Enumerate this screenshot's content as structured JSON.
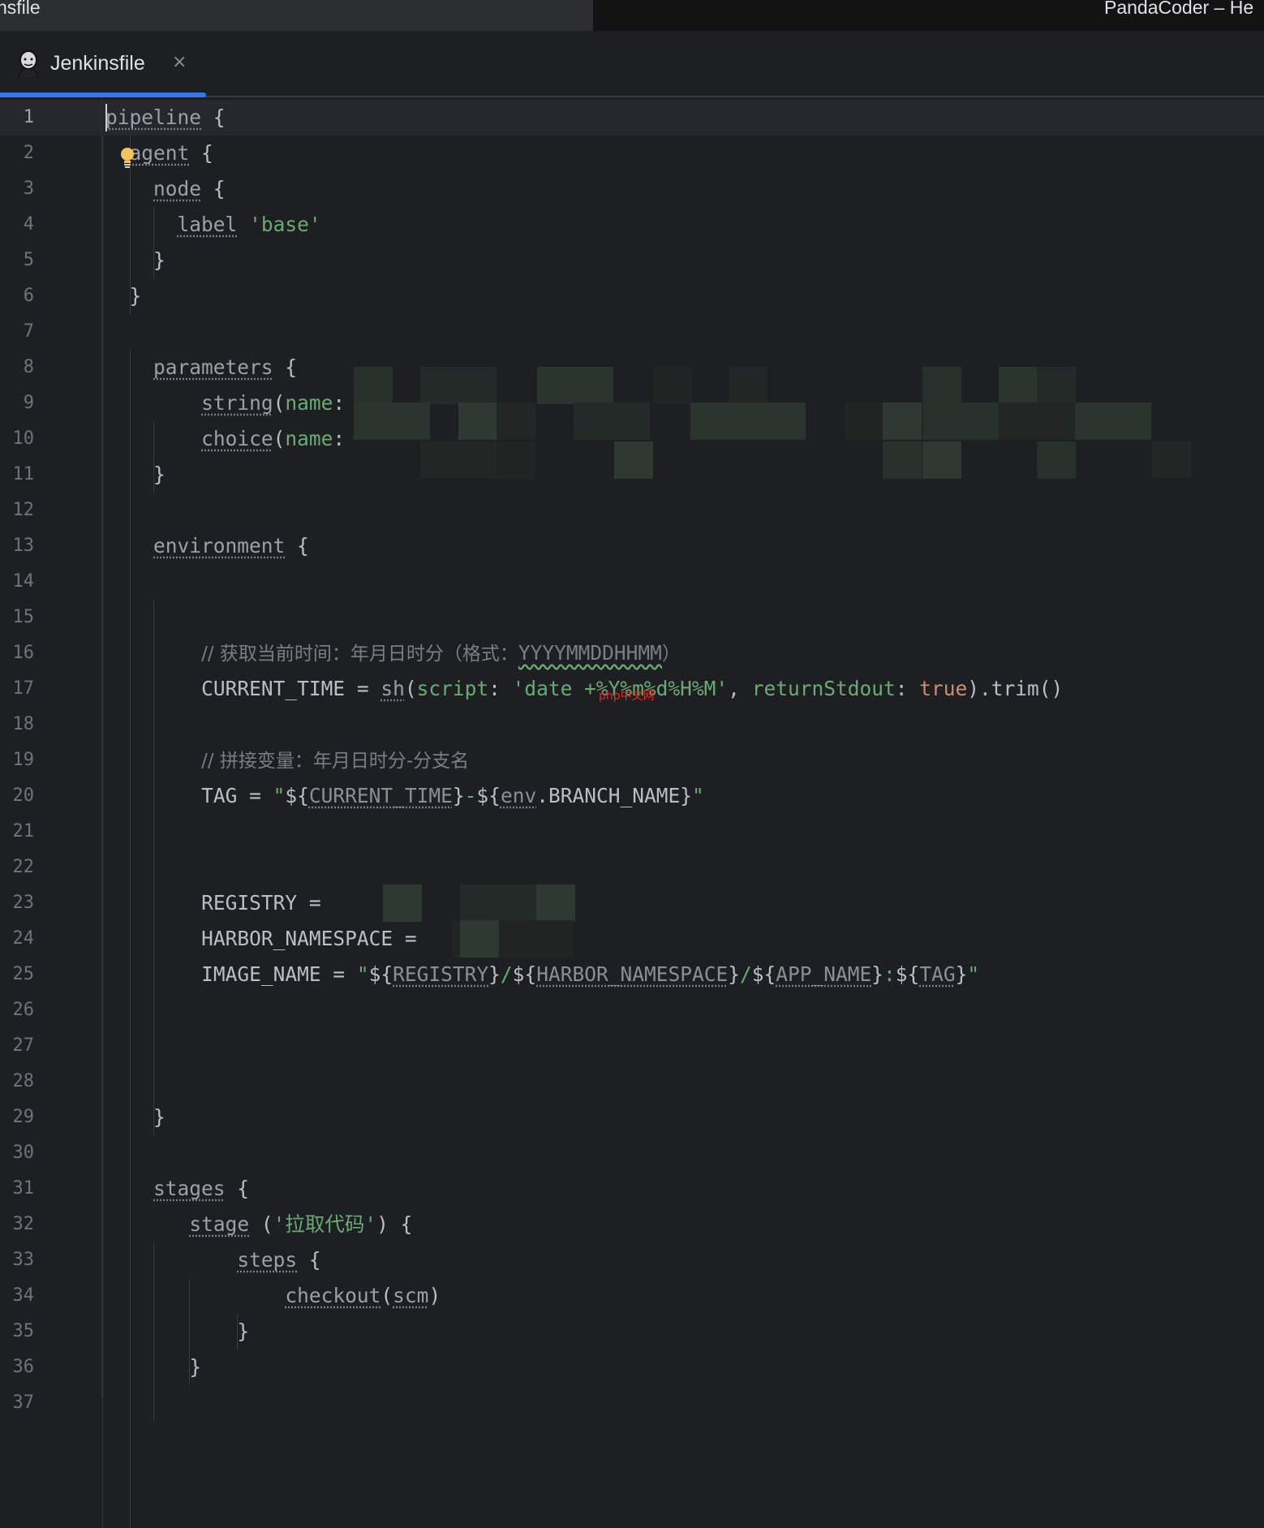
{
  "titlebar": {
    "left_text": "nsfile",
    "right_text": "PandaCoder – He"
  },
  "tab": {
    "label": "Jenkinsfile",
    "close": "×",
    "icon": "jenkins-icon"
  },
  "colors": {
    "background": "#1e1f22",
    "accent": "#3574f0",
    "string": "#6aab73",
    "keyword_true": "#cf8e6d",
    "comment": "#7a7e85"
  },
  "watermark": "php中文网",
  "editor": {
    "current_line": 1,
    "lines": [
      {
        "n": "1",
        "i": 0,
        "t": [
          [
            "k",
            "pipeline"
          ],
          [
            "p",
            " {"
          ]
        ]
      },
      {
        "n": "2",
        "i": 2,
        "t": [
          [
            "k",
            "agent"
          ],
          [
            "p",
            " {"
          ]
        ]
      },
      {
        "n": "3",
        "i": 4,
        "t": [
          [
            "k",
            "node"
          ],
          [
            "p",
            " {"
          ]
        ]
      },
      {
        "n": "4",
        "i": 6,
        "t": [
          [
            "k",
            "label"
          ],
          [
            "p",
            " "
          ],
          [
            "s",
            "'base'"
          ]
        ]
      },
      {
        "n": "5",
        "i": 4,
        "t": [
          [
            "p",
            "}"
          ]
        ]
      },
      {
        "n": "6",
        "i": 2,
        "t": [
          [
            "p",
            "}"
          ]
        ]
      },
      {
        "n": "7",
        "i": 0,
        "t": []
      },
      {
        "n": "8",
        "i": 4,
        "t": [
          [
            "k",
            "parameters"
          ],
          [
            "p",
            " {"
          ]
        ]
      },
      {
        "n": "9",
        "i": 8,
        "t": [
          [
            "k",
            "string"
          ],
          [
            "p",
            "("
          ],
          [
            "s",
            "name"
          ],
          [
            "p",
            ":"
          ]
        ]
      },
      {
        "n": "10",
        "i": 8,
        "t": [
          [
            "k",
            "choice"
          ],
          [
            "p",
            "("
          ],
          [
            "s",
            "name"
          ],
          [
            "p",
            ":"
          ]
        ]
      },
      {
        "n": "11",
        "i": 4,
        "t": [
          [
            "p",
            "}"
          ]
        ]
      },
      {
        "n": "12",
        "i": 0,
        "t": []
      },
      {
        "n": "13",
        "i": 4,
        "t": [
          [
            "k",
            "environment"
          ],
          [
            "p",
            " {"
          ]
        ]
      },
      {
        "n": "14",
        "i": 0,
        "t": []
      },
      {
        "n": "15",
        "i": 0,
        "t": []
      },
      {
        "n": "16",
        "i": 8,
        "t": [
          [
            "c",
            "// 获取当前时间：年月日时分（格式："
          ],
          [
            "cw",
            "YYYYMMDDHHMM"
          ],
          [
            "c",
            "）"
          ]
        ]
      },
      {
        "n": "17",
        "i": 8,
        "t": [
          [
            "p",
            "CURRENT_TIME = "
          ],
          [
            "k",
            "sh"
          ],
          [
            "p",
            "("
          ],
          [
            "s",
            "script"
          ],
          [
            "p",
            ": "
          ],
          [
            "s",
            "'date +%Y%m%d%H%M'"
          ],
          [
            "p",
            ", "
          ],
          [
            "s",
            "returnStdout"
          ],
          [
            "p",
            ": "
          ],
          [
            "b",
            "true"
          ],
          [
            "p",
            ").trim()"
          ]
        ]
      },
      {
        "n": "18",
        "i": 0,
        "t": []
      },
      {
        "n": "19",
        "i": 8,
        "t": [
          [
            "c",
            "// 拼接变量：年月日时分-分支名"
          ]
        ]
      },
      {
        "n": "20",
        "i": 8,
        "t": [
          [
            "p",
            "TAG = "
          ],
          [
            "s",
            "\""
          ],
          [
            "p",
            "${"
          ],
          [
            "v",
            "CURRENT_TIME"
          ],
          [
            "p",
            "}"
          ],
          [
            "s",
            "-"
          ],
          [
            "p",
            "${"
          ],
          [
            "v",
            "env"
          ],
          [
            "p",
            ".BRANCH_NAME}"
          ],
          [
            "s",
            "\""
          ]
        ]
      },
      {
        "n": "21",
        "i": 0,
        "t": []
      },
      {
        "n": "22",
        "i": 0,
        "t": []
      },
      {
        "n": "23",
        "i": 8,
        "t": [
          [
            "p",
            "REGISTRY = "
          ]
        ]
      },
      {
        "n": "24",
        "i": 8,
        "t": [
          [
            "p",
            "HARBOR_NAMESPACE = "
          ]
        ]
      },
      {
        "n": "25",
        "i": 8,
        "t": [
          [
            "p",
            "IMAGE_NAME = "
          ],
          [
            "s",
            "\""
          ],
          [
            "p",
            "${"
          ],
          [
            "v",
            "REGISTRY"
          ],
          [
            "p",
            "}"
          ],
          [
            "s",
            "/"
          ],
          [
            "p",
            "${"
          ],
          [
            "v",
            "HARBOR_NAMESPACE"
          ],
          [
            "p",
            "}"
          ],
          [
            "s",
            "/"
          ],
          [
            "p",
            "${"
          ],
          [
            "v",
            "APP_NAME"
          ],
          [
            "p",
            "}"
          ],
          [
            "s",
            ":"
          ],
          [
            "p",
            "${"
          ],
          [
            "v",
            "TAG"
          ],
          [
            "p",
            "}"
          ],
          [
            "s",
            "\""
          ]
        ]
      },
      {
        "n": "26",
        "i": 0,
        "t": []
      },
      {
        "n": "27",
        "i": 0,
        "t": []
      },
      {
        "n": "28",
        "i": 0,
        "t": []
      },
      {
        "n": "29",
        "i": 4,
        "t": [
          [
            "p",
            "}"
          ]
        ]
      },
      {
        "n": "30",
        "i": 0,
        "t": []
      },
      {
        "n": "31",
        "i": 4,
        "t": [
          [
            "k",
            "stages"
          ],
          [
            "p",
            " {"
          ]
        ]
      },
      {
        "n": "32",
        "i": 7,
        "t": [
          [
            "k",
            "stage"
          ],
          [
            "p",
            " ("
          ],
          [
            "s",
            "'拉取代码'"
          ],
          [
            "p",
            ") {"
          ]
        ]
      },
      {
        "n": "33",
        "i": 11,
        "t": [
          [
            "k",
            "steps"
          ],
          [
            "p",
            " {"
          ]
        ]
      },
      {
        "n": "34",
        "i": 15,
        "t": [
          [
            "k",
            "checkout"
          ],
          [
            "p",
            "("
          ],
          [
            "k",
            "scm"
          ],
          [
            "p",
            ")"
          ]
        ]
      },
      {
        "n": "35",
        "i": 11,
        "t": [
          [
            "p",
            "}"
          ]
        ]
      },
      {
        "n": "36",
        "i": 7,
        "t": [
          [
            "p",
            "}"
          ]
        ]
      },
      {
        "n": "37",
        "i": 0,
        "t": []
      }
    ]
  }
}
